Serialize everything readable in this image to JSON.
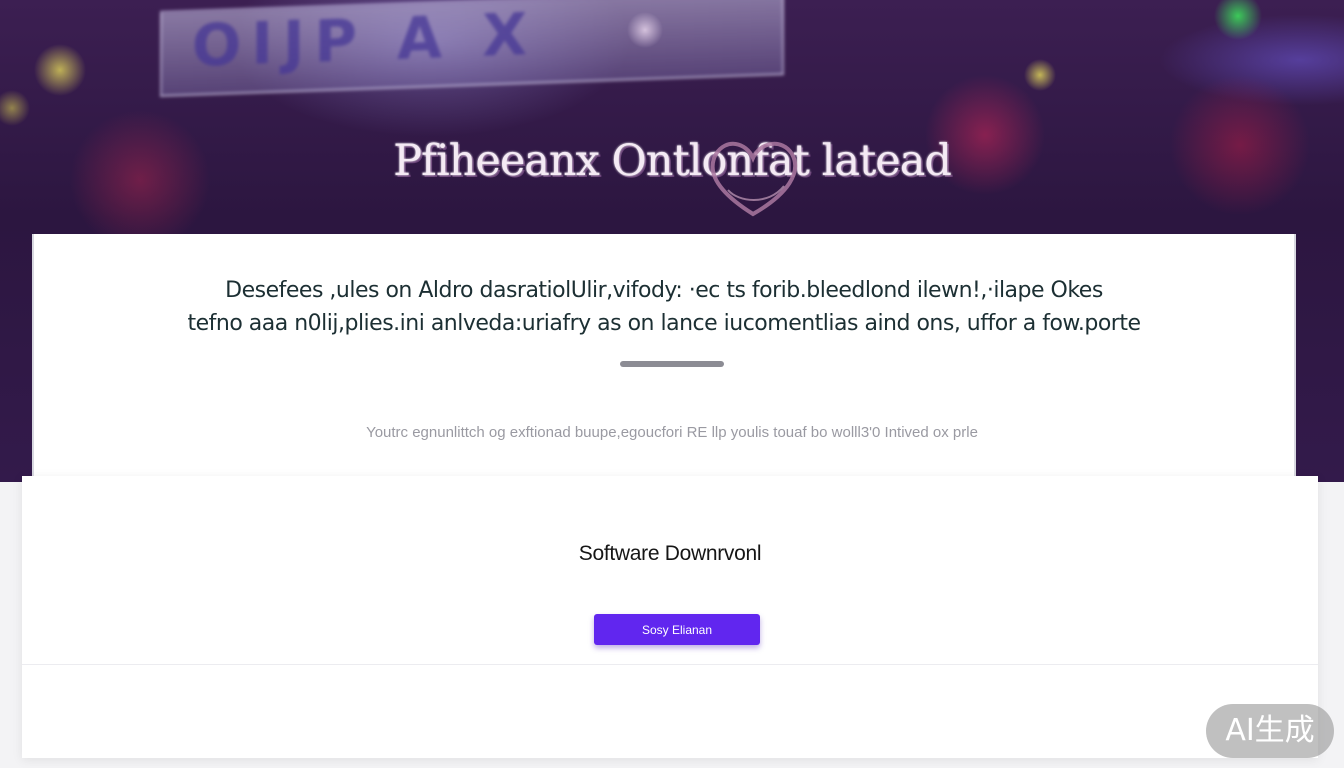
{
  "hero": {
    "sign_text": "OIJP A X",
    "title": "Pfiheeanx Ontlonfat latead"
  },
  "description": {
    "line1": "Desefees ,ules on Aldro dasratiolUlir,vifody: ·ec ts forib.bleedlond ilewn!,·ilape Okes",
    "line2": "tefno aaa n0lij,plies.ini anlveda:uriafry as on lance iucomentlias aind ons, uffor a fow.porte",
    "meta": "Youtrc egnunlittch og exftionad buupe,egoucfori RE llp youlis touaf bo wolll3'0 Intived ox prle"
  },
  "download": {
    "title": "Software Downrvonl",
    "button_label": "Sosy Elianan"
  },
  "watermark": {
    "text": "AI生成"
  },
  "colors": {
    "hero_bg": "#2c1640",
    "button": "#6126ef",
    "card": "#ffffff"
  }
}
